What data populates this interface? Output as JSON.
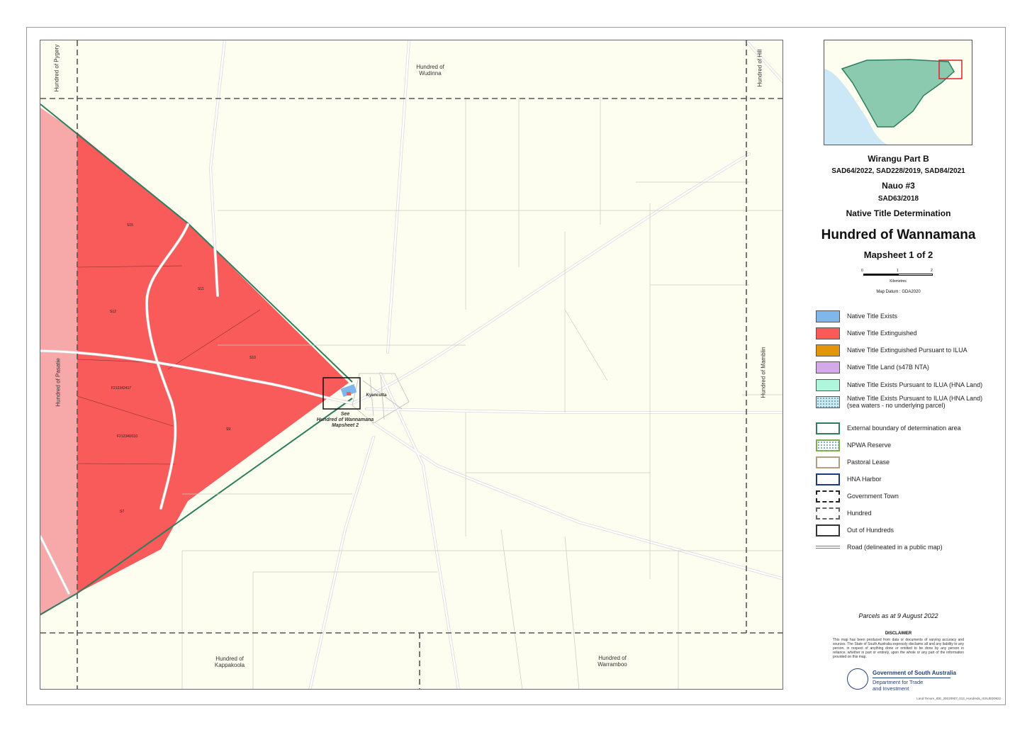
{
  "map": {
    "title": "Wirangu Part B",
    "cases_1": "SAD64/2022, SAD228/2019, SAD84/2021",
    "subtitle_2": "Nauo #3",
    "cases_2": "SAD63/2018",
    "determination": "Native Title Determination",
    "hundred_title": "Hundred of Wannamana",
    "mapsheet": "Mapsheet 1 of 2",
    "scale": {
      "ticks": [
        "0",
        "1",
        "2"
      ],
      "unit": "Kilometres"
    },
    "datum": "Map Datum : GDA2020",
    "parcels_note": "Parcels as at 9 August 2022",
    "disclaimer_title": "DISCLAIMER",
    "disclaimer_text": "This map has been produced from data or documents of varying accuracy and sources. The State of South Australia expressly disclaims all and any liability to any person, in respect of anything done or omitted to be done by any person in reliance, whether in part or entirely, upon the whole or any part of the information provided on this map.",
    "agency": {
      "line1": "Government of South Australia",
      "line2": "Department for Trade",
      "line3": "and Investment"
    },
    "footer_code": "Land Tenure_IDE_20220907_013_Hundreds_ISSUED0822"
  },
  "legend": [
    {
      "label": "Native Title Exists",
      "color": "#7db7ec",
      "border": "#555"
    },
    {
      "label": "Native Title Extinguished",
      "color": "#f95a5a",
      "border": "#555"
    },
    {
      "label": "Native Title Extinguished Pursuant to ILUA",
      "color": "#e3940a",
      "border": "#555"
    },
    {
      "label": "Native Title Land (s47B NTA)",
      "color": "#d3a9e8",
      "border": "#555"
    },
    {
      "label": "Native Title Exists Pursuant to ILUA (HNA Land)",
      "color": "#aef7dd",
      "border": "#555"
    },
    {
      "label": "Native Title Exists Pursuant to ILUA (HNA Land) (sea waters - no underlying parcel)",
      "color": "#cde9f0",
      "border": "#555",
      "pattern": "dots"
    },
    {
      "label": "External boundary of determination area",
      "color": "#ffffff",
      "border": "#2e7d5e"
    },
    {
      "label": "NPWA Reserve",
      "color": "#ffffff",
      "border": "#7bb04a",
      "pattern": "dots"
    },
    {
      "label": "Pastoral Lease",
      "color": "#ffffff",
      "border": "#b0a080"
    },
    {
      "label": "HNA Harbor",
      "color": "#ffffff",
      "border": "#1f3a7a"
    },
    {
      "label": "Government Town",
      "color": "#ffffff",
      "border": "#222",
      "dash": "dashdot"
    },
    {
      "label": "Hundred",
      "color": "#ffffff",
      "border": "#666",
      "dash": "dash"
    },
    {
      "label": "Out of Hundreds",
      "color": "#ffffff",
      "border": "#333"
    },
    {
      "label": "Road (delineated in a public map)",
      "color": "road"
    }
  ],
  "places": {
    "pygery": "Hundred of Pygery",
    "wudinna": "Hundred of Wudinna",
    "hill": "Hundred of Hill",
    "pasatie": "Hundred of Pasatie",
    "mamblin": "Hundred of Mamblin",
    "kappakoola": "Hundred of Kappakoola",
    "warramboo": "Hundred of Warramboo",
    "kyancutta": "Kyancutta",
    "see_1": "See",
    "see_2": "Hundred of Wannamana",
    "see_3": "Mapsheet 2"
  },
  "lots": [
    "S15",
    "S11",
    "S12",
    "S10",
    "F212342417",
    "F212340/110",
    "S9",
    "S7"
  ]
}
